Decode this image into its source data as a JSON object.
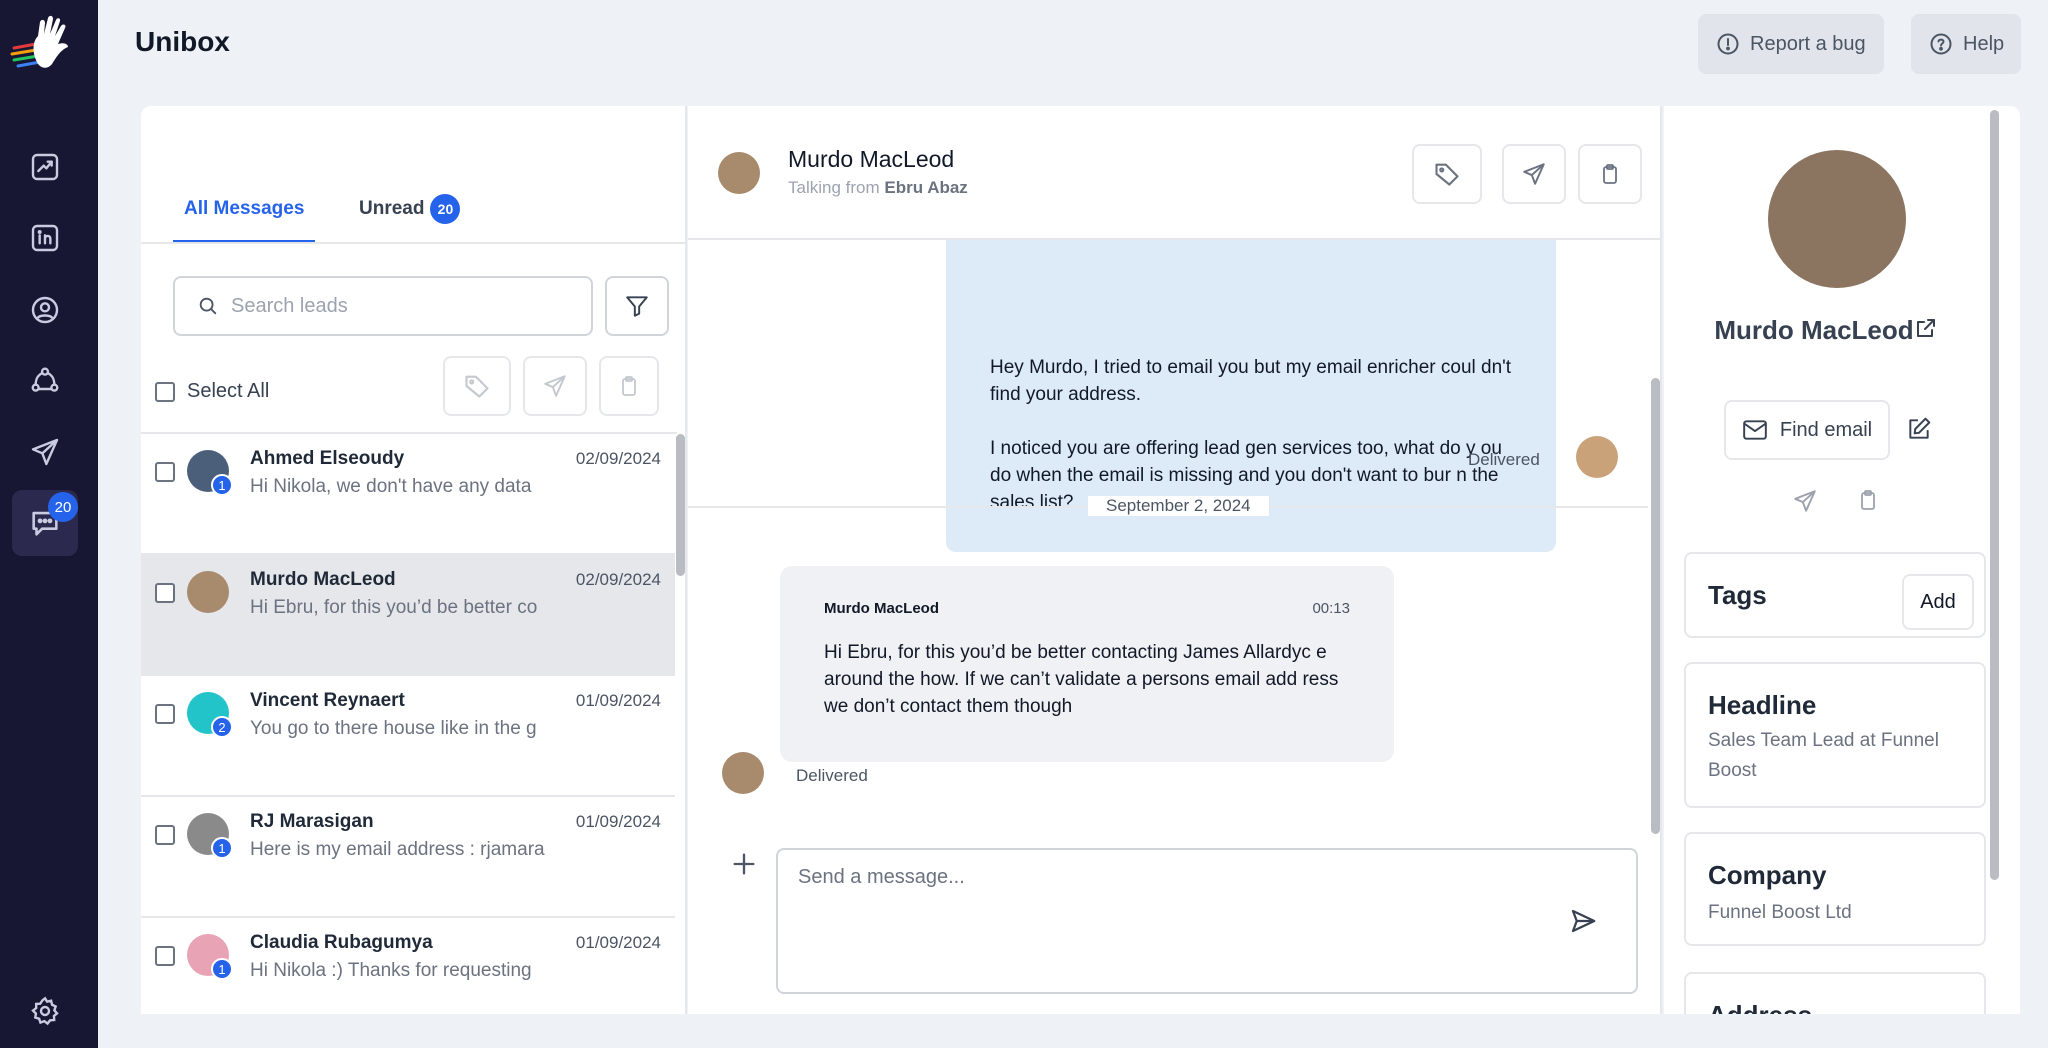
{
  "page": {
    "title": "Unibox"
  },
  "topbar": {
    "report_bug": "Report a bug",
    "help": "Help"
  },
  "nav": {
    "items": [
      {
        "icon": "analytics-icon"
      },
      {
        "icon": "linkedin-icon"
      },
      {
        "icon": "user-circle-icon"
      },
      {
        "icon": "network-icon"
      },
      {
        "icon": "send-icon"
      },
      {
        "icon": "chat-icon",
        "badge": "20"
      }
    ],
    "settings_icon": "gear-icon"
  },
  "list": {
    "tabs": [
      {
        "label": "All Messages",
        "active": true
      },
      {
        "label": "Unread",
        "badge": "20"
      }
    ],
    "search_placeholder": "Search leads",
    "select_all": "Select All",
    "leads": [
      {
        "name": "Ahmed Elseoudy",
        "date": "02/09/2024",
        "snippet": "Hi Nikola, we don't have any data",
        "count": "1",
        "color": "#4b5f7a"
      },
      {
        "name": "Murdo MacLeod",
        "date": "02/09/2024",
        "snippet": "Hi Ebru, for this you’d be better co",
        "count": "",
        "color": "#a88a6c"
      },
      {
        "name": "Vincent Reynaert",
        "date": "01/09/2024",
        "snippet": "You go to there house like in the g",
        "count": "2",
        "color": "#22c3c9"
      },
      {
        "name": "RJ Marasigan",
        "date": "01/09/2024",
        "snippet": "Here is my email address : rjamara",
        "count": "1",
        "color": "#8a8a8a"
      },
      {
        "name": "Claudia Rubagumya",
        "date": "01/09/2024",
        "snippet": "Hi Nikola :) Thanks for requesting",
        "count": "1",
        "color": "#e8a3b5"
      }
    ]
  },
  "chat": {
    "name": "Murdo MacLeod",
    "talking_from_label": "Talking from",
    "talking_from": "Ebru Abaz",
    "outgoing": {
      "line1": "Hey Murdo, I tried to email you but my email enricher coul dn't find your address.",
      "line2": "I noticed you are offering lead gen services too, what do y ou do when the email is missing and you don't want to bur n the sales list?",
      "status": "Delivered"
    },
    "date_separator": "September 2, 2024",
    "incoming": {
      "sender": "Murdo MacLeod",
      "time": "00:13",
      "text": "Hi Ebru, for this you’d be better contacting James Allardyc e around the how. If we can’t validate a persons email add ress we don’t contact them though",
      "status": "Delivered"
    },
    "composer_placeholder": "Send a message..."
  },
  "profile": {
    "name": "Murdo MacLeod",
    "find_email": "Find email",
    "tags_title": "Tags",
    "tags_add": "Add",
    "headline_title": "Headline",
    "headline": "Sales Team Lead at Funnel Boost",
    "company_title": "Company",
    "company": "Funnel Boost Ltd",
    "address_title": "Address"
  },
  "colors": {
    "accent": "#2563eb",
    "rail": "#171633",
    "outgoing_bubble": "#ddebf8"
  }
}
